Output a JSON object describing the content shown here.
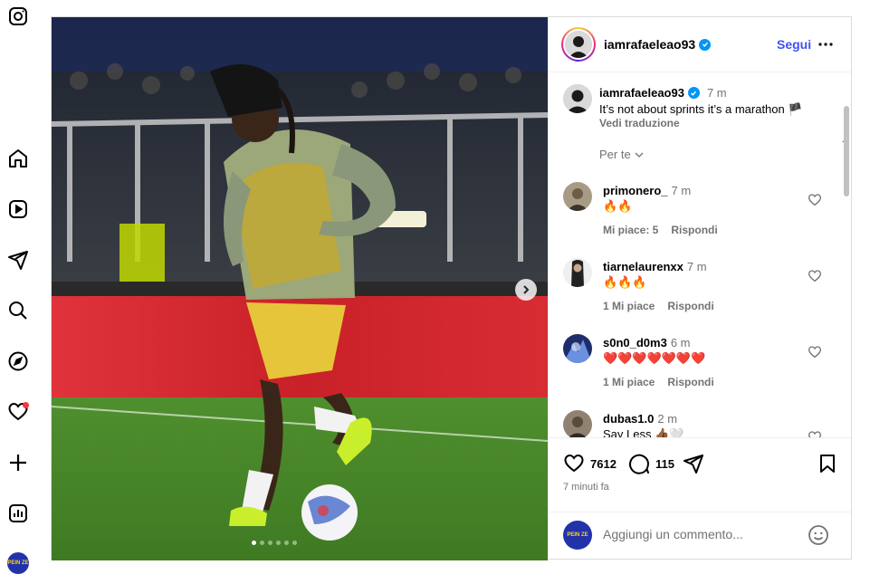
{
  "app": {
    "name": "Instagram"
  },
  "sidebar": {
    "items": [
      {
        "name": "home"
      },
      {
        "name": "reels"
      },
      {
        "name": "messages"
      },
      {
        "name": "search"
      },
      {
        "name": "explore"
      },
      {
        "name": "notifications",
        "has_badge": true
      },
      {
        "name": "create"
      },
      {
        "name": "dashboard"
      }
    ],
    "avatar_text": "PEIN ZE"
  },
  "post": {
    "carousel": {
      "count": 6,
      "active_index": 0
    },
    "header": {
      "username": "iamrafaeleao93",
      "verified": true,
      "follow_label": "Segui"
    },
    "caption": {
      "username": "iamrafaeleao93",
      "time": "7 m",
      "text": "It’s not about sprints it’s a marathon 🏴",
      "translate_label": "Vedi traduzione"
    },
    "filter_label": "Per te",
    "comments": [
      {
        "username": "primonero_",
        "time": "7 m",
        "text": "🔥🔥",
        "likes": "Mi piace: 5",
        "reply": "Rispondi"
      },
      {
        "username": "tiarnelaurenxx",
        "time": "7 m",
        "text": "🔥🔥🔥",
        "likes": "1 Mi piace",
        "reply": "Rispondi"
      },
      {
        "username": "s0n0_d0m3",
        "time": "6 m",
        "text": "❤️❤️❤️❤️❤️❤️❤️",
        "likes": "1 Mi piace",
        "reply": "Rispondi"
      },
      {
        "username": "dubas1.0",
        "time": "2 m",
        "text": "Say Less 👍🏾🤍",
        "likes": "",
        "reply": ""
      }
    ],
    "actions": {
      "likes": "7612",
      "comments": "115"
    },
    "posted_ago": "7 minuti fa",
    "add_comment": {
      "placeholder": "Aggiungi un commento...",
      "avatar_text": "PEIN ZE"
    }
  },
  "colors": {
    "accent": "#4150f7",
    "verified": "#0095f6",
    "notification": "#ff3040"
  }
}
